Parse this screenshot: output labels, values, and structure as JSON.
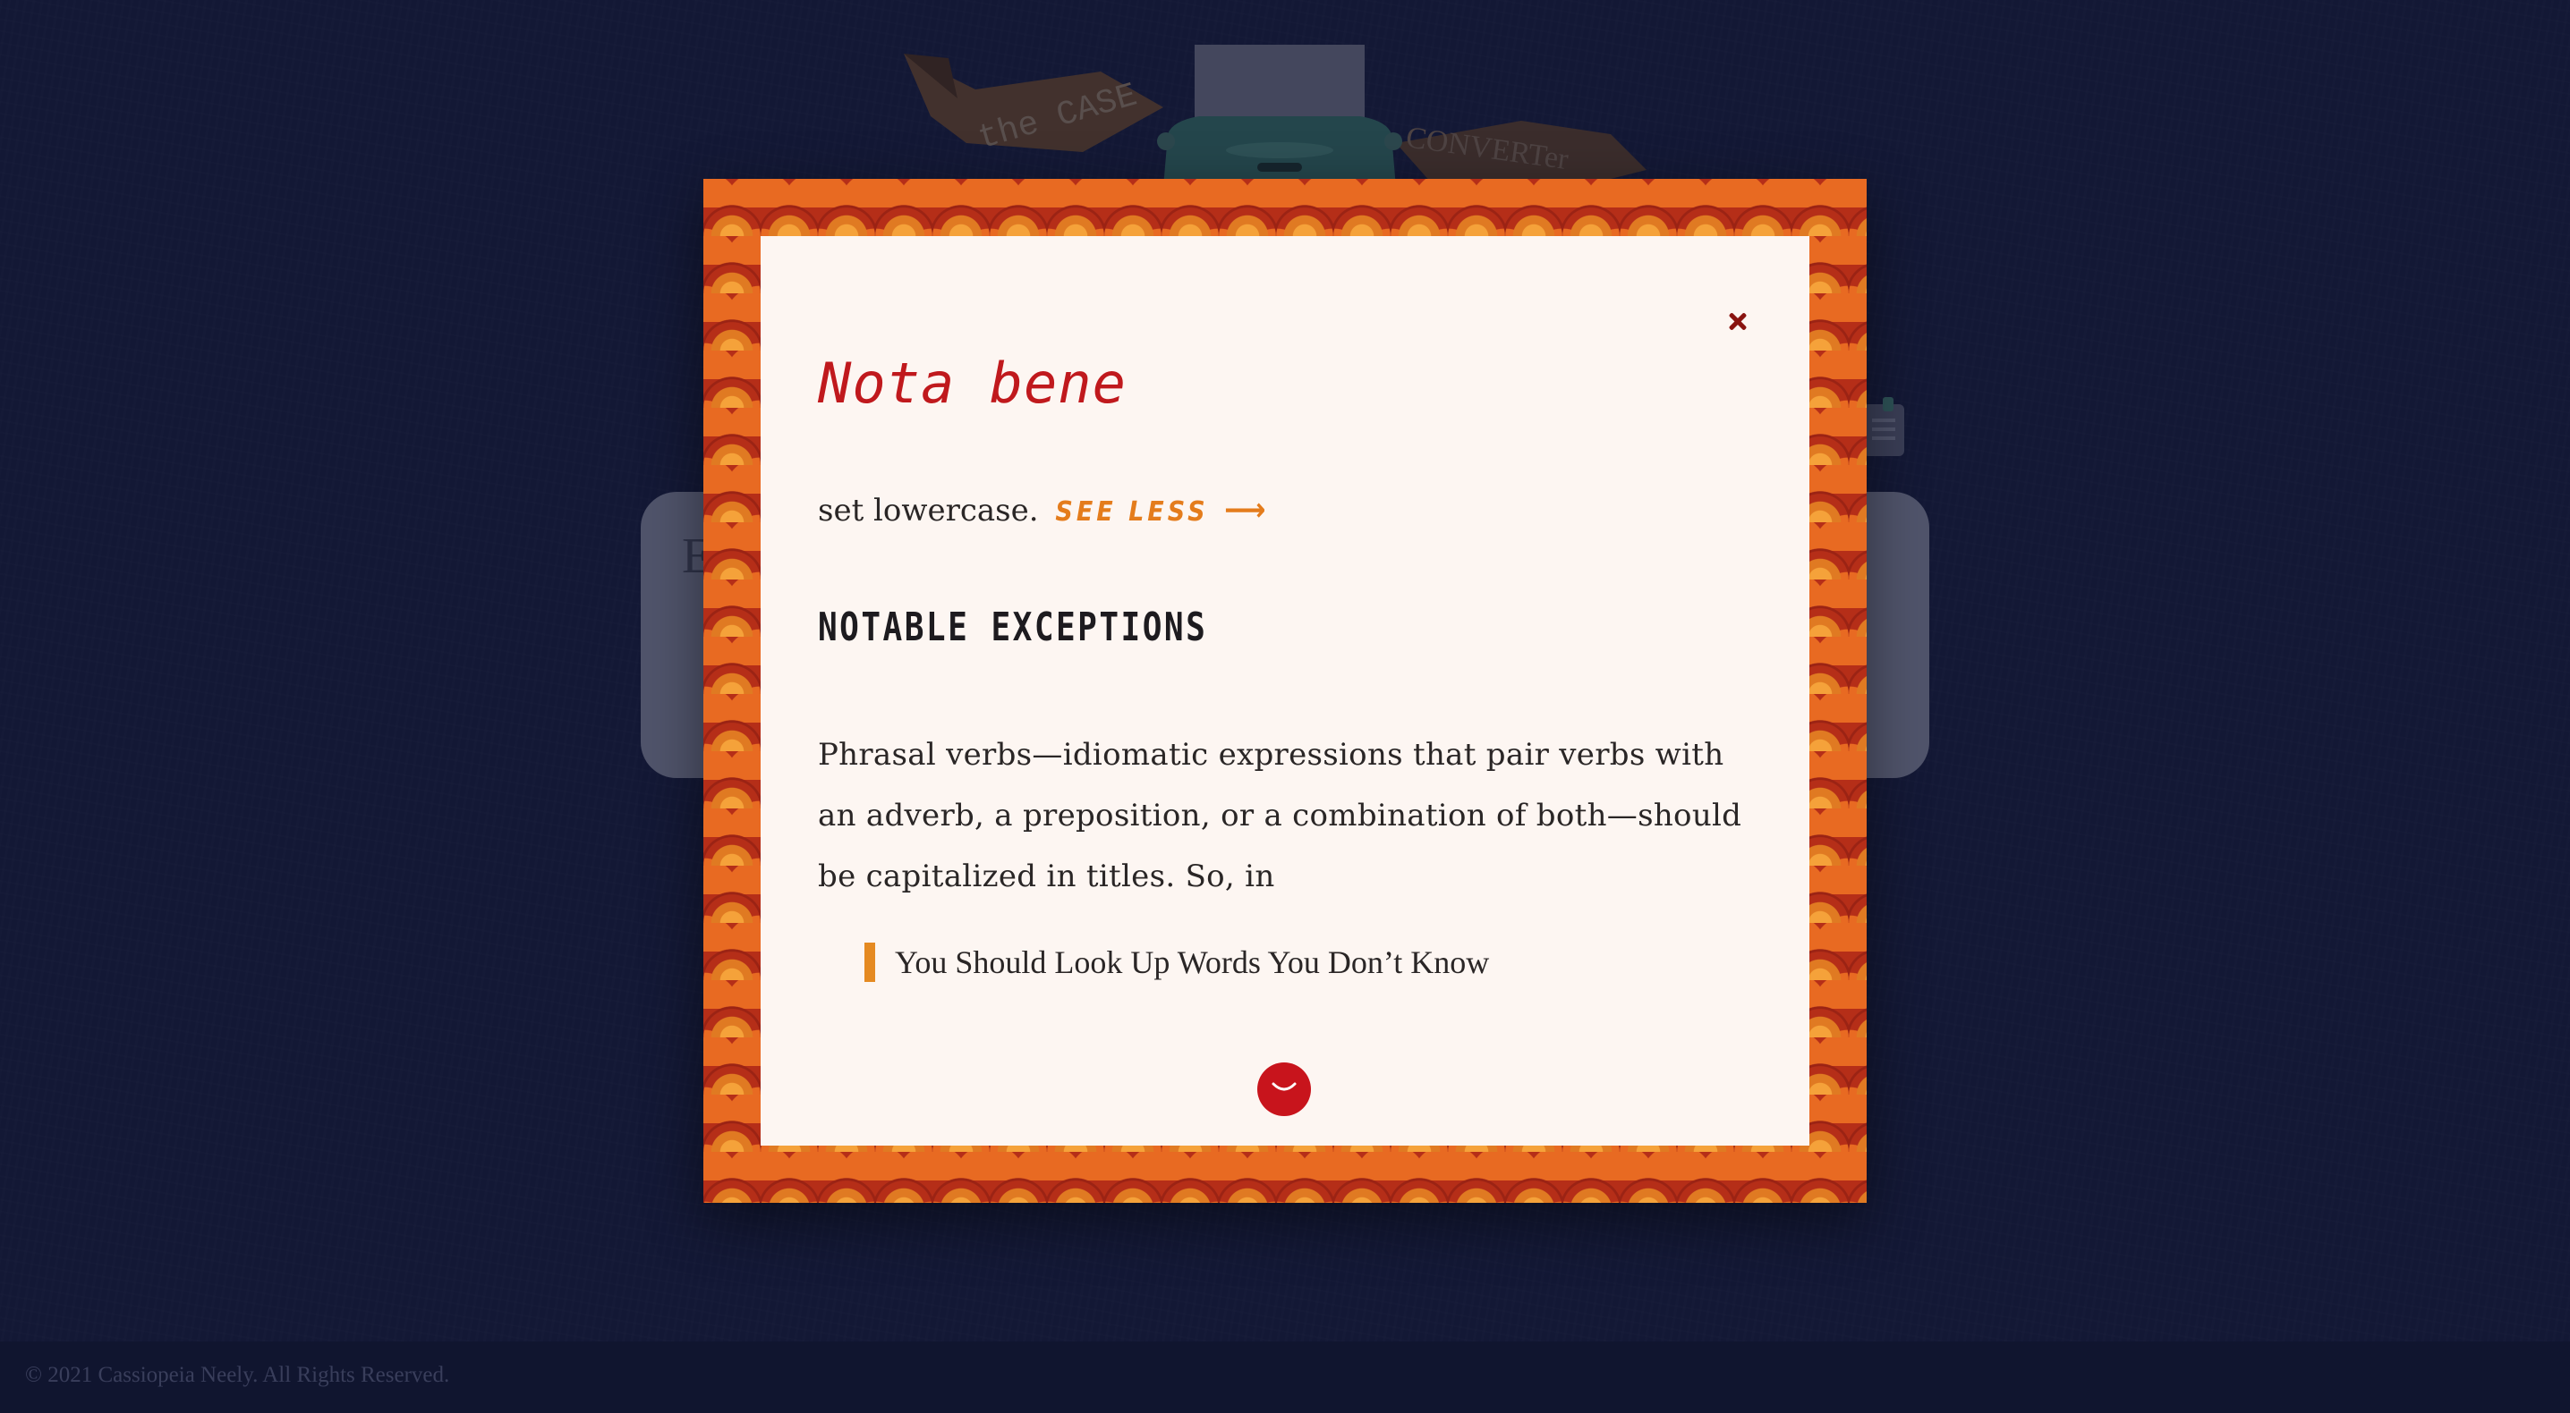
{
  "logo": {
    "ribbon_left_text": "the CASE",
    "ribbon_right_text": "CONVERTer"
  },
  "footer": {
    "copyright": "© 2021 Cassiopeia Neely. All Rights Reserved."
  },
  "modal": {
    "title": "Nota bene",
    "intro_text": "set lowercase.",
    "see_less_label": "SEE LESS",
    "see_less_arrow": "⟶",
    "section_heading": "NOTABLE EXCEPTIONS",
    "paragraph": "Phrasal verbs—idiomatic expressions that pair verbs with an adverb, a preposition, or a combination of both—should be capitalized in titles. So, in",
    "example": "You Should Look Up Words You Don’t Know",
    "close_icon": "close-icon",
    "scroll_icon": "chevron-down-icon"
  },
  "colors": {
    "accent_red": "#c0191d",
    "accent_orange": "#e47c1c",
    "paper": "#fdf6f2",
    "page_background": "#161c3c"
  }
}
